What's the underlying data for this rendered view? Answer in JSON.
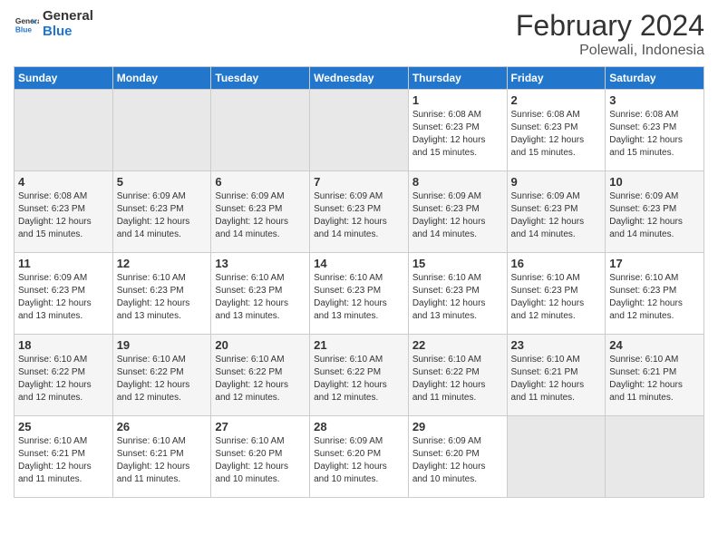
{
  "header": {
    "logo_line1": "General",
    "logo_line2": "Blue",
    "title": "February 2024",
    "subtitle": "Polewali, Indonesia"
  },
  "days_of_week": [
    "Sunday",
    "Monday",
    "Tuesday",
    "Wednesday",
    "Thursday",
    "Friday",
    "Saturday"
  ],
  "weeks": [
    [
      {
        "day": "",
        "info": ""
      },
      {
        "day": "",
        "info": ""
      },
      {
        "day": "",
        "info": ""
      },
      {
        "day": "",
        "info": ""
      },
      {
        "day": "1",
        "info": "Sunrise: 6:08 AM\nSunset: 6:23 PM\nDaylight: 12 hours and 15 minutes."
      },
      {
        "day": "2",
        "info": "Sunrise: 6:08 AM\nSunset: 6:23 PM\nDaylight: 12 hours and 15 minutes."
      },
      {
        "day": "3",
        "info": "Sunrise: 6:08 AM\nSunset: 6:23 PM\nDaylight: 12 hours and 15 minutes."
      }
    ],
    [
      {
        "day": "4",
        "info": "Sunrise: 6:08 AM\nSunset: 6:23 PM\nDaylight: 12 hours and 15 minutes."
      },
      {
        "day": "5",
        "info": "Sunrise: 6:09 AM\nSunset: 6:23 PM\nDaylight: 12 hours and 14 minutes."
      },
      {
        "day": "6",
        "info": "Sunrise: 6:09 AM\nSunset: 6:23 PM\nDaylight: 12 hours and 14 minutes."
      },
      {
        "day": "7",
        "info": "Sunrise: 6:09 AM\nSunset: 6:23 PM\nDaylight: 12 hours and 14 minutes."
      },
      {
        "day": "8",
        "info": "Sunrise: 6:09 AM\nSunset: 6:23 PM\nDaylight: 12 hours and 14 minutes."
      },
      {
        "day": "9",
        "info": "Sunrise: 6:09 AM\nSunset: 6:23 PM\nDaylight: 12 hours and 14 minutes."
      },
      {
        "day": "10",
        "info": "Sunrise: 6:09 AM\nSunset: 6:23 PM\nDaylight: 12 hours and 14 minutes."
      }
    ],
    [
      {
        "day": "11",
        "info": "Sunrise: 6:09 AM\nSunset: 6:23 PM\nDaylight: 12 hours and 13 minutes."
      },
      {
        "day": "12",
        "info": "Sunrise: 6:10 AM\nSunset: 6:23 PM\nDaylight: 12 hours and 13 minutes."
      },
      {
        "day": "13",
        "info": "Sunrise: 6:10 AM\nSunset: 6:23 PM\nDaylight: 12 hours and 13 minutes."
      },
      {
        "day": "14",
        "info": "Sunrise: 6:10 AM\nSunset: 6:23 PM\nDaylight: 12 hours and 13 minutes."
      },
      {
        "day": "15",
        "info": "Sunrise: 6:10 AM\nSunset: 6:23 PM\nDaylight: 12 hours and 13 minutes."
      },
      {
        "day": "16",
        "info": "Sunrise: 6:10 AM\nSunset: 6:23 PM\nDaylight: 12 hours and 12 minutes."
      },
      {
        "day": "17",
        "info": "Sunrise: 6:10 AM\nSunset: 6:23 PM\nDaylight: 12 hours and 12 minutes."
      }
    ],
    [
      {
        "day": "18",
        "info": "Sunrise: 6:10 AM\nSunset: 6:22 PM\nDaylight: 12 hours and 12 minutes."
      },
      {
        "day": "19",
        "info": "Sunrise: 6:10 AM\nSunset: 6:22 PM\nDaylight: 12 hours and 12 minutes."
      },
      {
        "day": "20",
        "info": "Sunrise: 6:10 AM\nSunset: 6:22 PM\nDaylight: 12 hours and 12 minutes."
      },
      {
        "day": "21",
        "info": "Sunrise: 6:10 AM\nSunset: 6:22 PM\nDaylight: 12 hours and 12 minutes."
      },
      {
        "day": "22",
        "info": "Sunrise: 6:10 AM\nSunset: 6:22 PM\nDaylight: 12 hours and 11 minutes."
      },
      {
        "day": "23",
        "info": "Sunrise: 6:10 AM\nSunset: 6:21 PM\nDaylight: 12 hours and 11 minutes."
      },
      {
        "day": "24",
        "info": "Sunrise: 6:10 AM\nSunset: 6:21 PM\nDaylight: 12 hours and 11 minutes."
      }
    ],
    [
      {
        "day": "25",
        "info": "Sunrise: 6:10 AM\nSunset: 6:21 PM\nDaylight: 12 hours and 11 minutes."
      },
      {
        "day": "26",
        "info": "Sunrise: 6:10 AM\nSunset: 6:21 PM\nDaylight: 12 hours and 11 minutes."
      },
      {
        "day": "27",
        "info": "Sunrise: 6:10 AM\nSunset: 6:20 PM\nDaylight: 12 hours and 10 minutes."
      },
      {
        "day": "28",
        "info": "Sunrise: 6:09 AM\nSunset: 6:20 PM\nDaylight: 12 hours and 10 minutes."
      },
      {
        "day": "29",
        "info": "Sunrise: 6:09 AM\nSunset: 6:20 PM\nDaylight: 12 hours and 10 minutes."
      },
      {
        "day": "",
        "info": ""
      },
      {
        "day": "",
        "info": ""
      }
    ]
  ]
}
